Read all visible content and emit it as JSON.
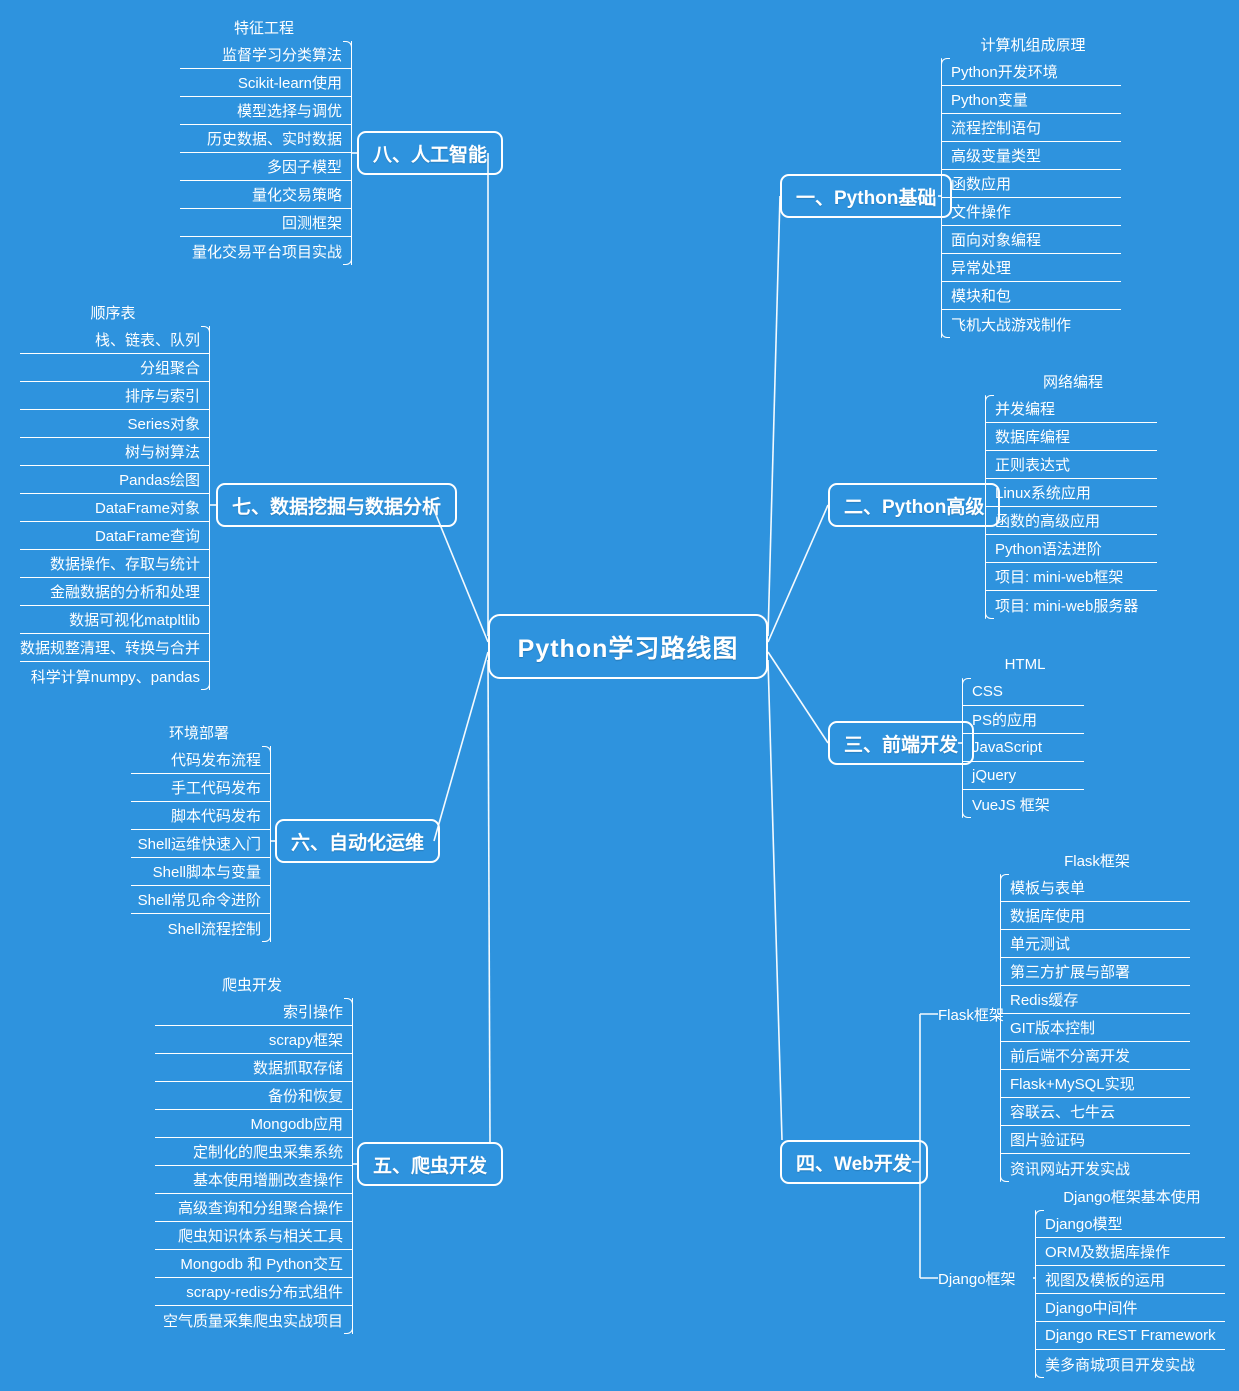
{
  "meta": {
    "title": "Python学习路线图",
    "background_color": "#2e93de",
    "line_color": "#ffffff",
    "text_color": "#ffffff"
  },
  "root": {
    "label": "Python学习路线图"
  },
  "branches": [
    {
      "id": "ai",
      "label": "八、人工智能",
      "side": "left",
      "items": [
        "特征工程",
        "监督学习分类算法",
        "Scikit-learn使用",
        "模型选择与调优",
        "历史数据、实时数据",
        "多因子模型",
        "量化交易策略",
        "回测框架",
        "量化交易平台项目实战"
      ]
    },
    {
      "id": "data-mining",
      "label": "七、数据挖掘与数据分析",
      "side": "left",
      "items": [
        "顺序表",
        "栈、链表、队列",
        "分组聚合",
        "排序与索引",
        "Series对象",
        "树与树算法",
        "Pandas绘图",
        "DataFrame对象",
        "DataFrame查询",
        "数据操作、存取与统计",
        "金融数据的分析和处理",
        "数据可视化matpltlib",
        "数据规整清理、转换与合并",
        "科学计算numpy、pandas"
      ]
    },
    {
      "id": "devops",
      "label": "六、自动化运维",
      "side": "left",
      "items": [
        "环境部署",
        "代码发布流程",
        "手工代码发布",
        "脚本代码发布",
        "Shell运维快速入门",
        "Shell脚本与变量",
        "Shell常见命令进阶",
        "Shell流程控制"
      ]
    },
    {
      "id": "spider",
      "label": "五、爬虫开发",
      "side": "left",
      "items": [
        "爬虫开发",
        "索引操作",
        "scrapy框架",
        "数据抓取存储",
        "备份和恢复",
        "Mongodb应用",
        "定制化的爬虫采集系统",
        "基本使用增删改查操作",
        "高级查询和分组聚合操作",
        "爬虫知识体系与相关工具",
        "Mongodb 和 Python交互",
        "scrapy-redis分布式组件",
        "空气质量采集爬虫实战项目"
      ]
    },
    {
      "id": "python-basics",
      "label": "一、Python基础",
      "side": "right",
      "items": [
        "计算机组成原理",
        "Python开发环境",
        "Python变量",
        "流程控制语句",
        "高级变量类型",
        "函数应用",
        "文件操作",
        "面向对象编程",
        "异常处理",
        "模块和包",
        "飞机大战游戏制作"
      ]
    },
    {
      "id": "python-advanced",
      "label": "二、Python高级",
      "side": "right",
      "items": [
        "网络编程",
        "并发编程",
        "数据库编程",
        "正则表达式",
        "Linux系统应用",
        "函数的高级应用",
        "Python语法进阶",
        "项目: mini-web框架",
        "项目: mini-web服务器"
      ]
    },
    {
      "id": "frontend",
      "label": "三、前端开发",
      "side": "right",
      "items": [
        "HTML",
        "CSS",
        "PS的应用",
        "JavaScript",
        "jQuery",
        "VueJS 框架"
      ]
    },
    {
      "id": "web",
      "label": "四、Web开发",
      "side": "right",
      "subgroups": [
        {
          "id": "flask",
          "label": "Flask框架",
          "items": [
            "Flask框架",
            "模板与表单",
            "数据库使用",
            "单元测试",
            "第三方扩展与部署",
            "Redis缓存",
            "GIT版本控制",
            "前后端不分离开发",
            "Flask+MySQL实现",
            "容联云、七牛云",
            "图片验证码",
            "资讯网站开发实战"
          ]
        },
        {
          "id": "django",
          "label": "Django框架",
          "items": [
            "Django框架基本使用",
            "Django模型",
            "ORM及数据库操作",
            "视图及模板的运用",
            "Django中间件",
            "Django REST Framework",
            "美多商城项目开发实战"
          ]
        }
      ]
    }
  ]
}
